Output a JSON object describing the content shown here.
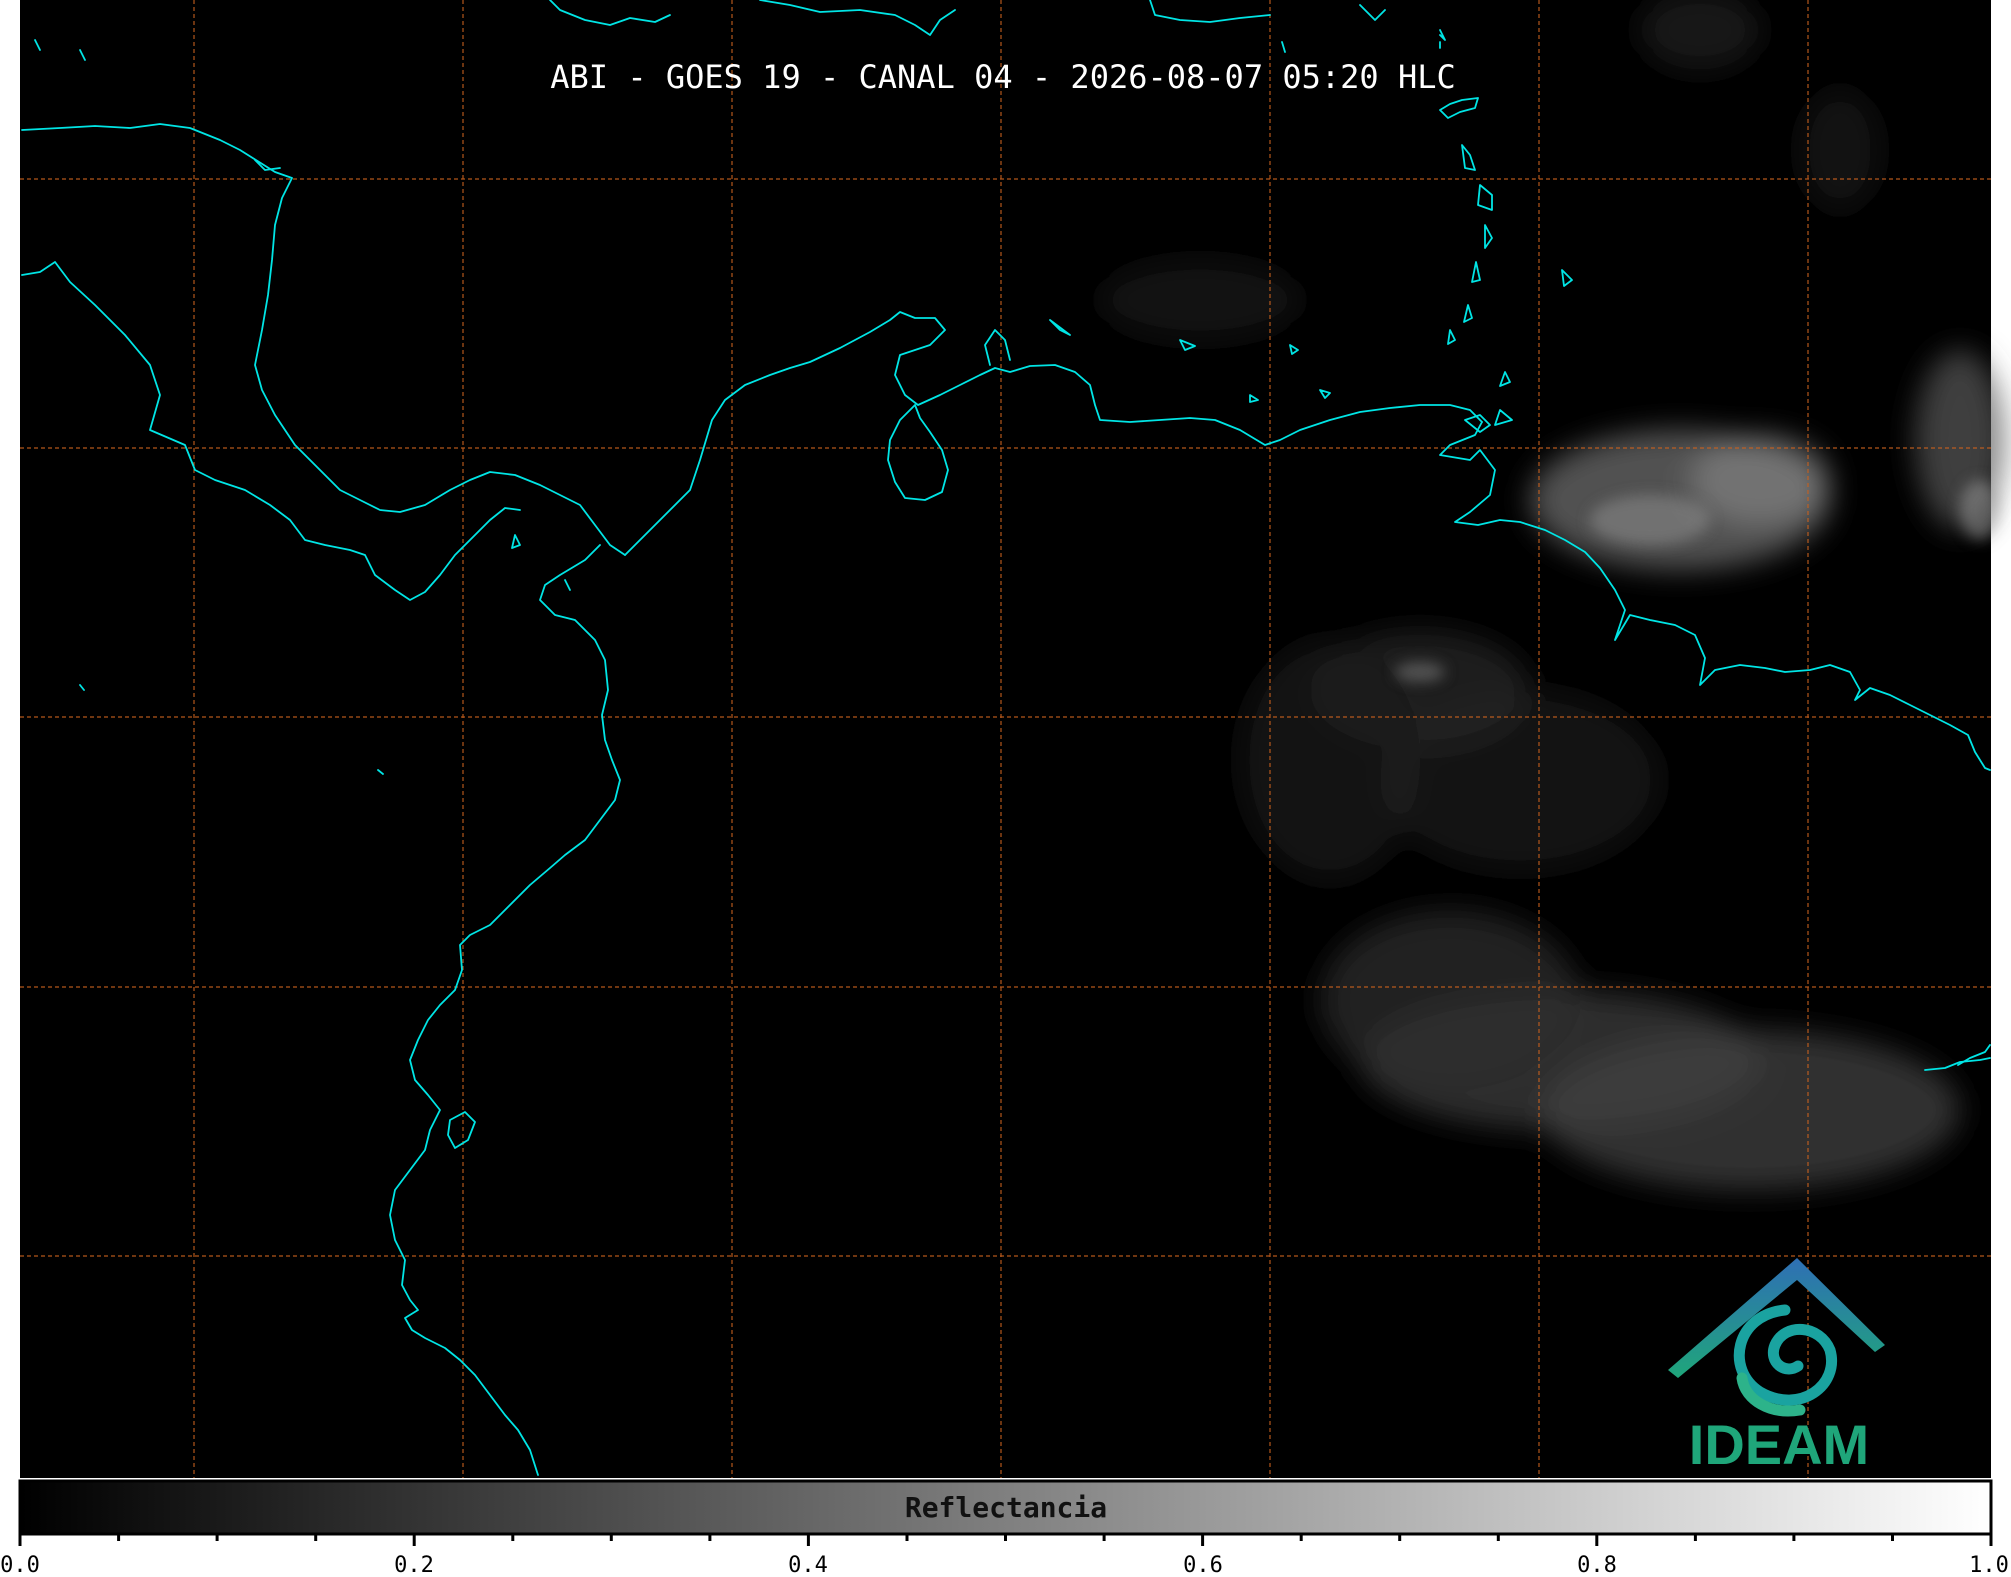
{
  "title": "ABI - GOES 19 - CANAL 04 - 2026-08-07 05:20 HLC",
  "colorbar": {
    "label": "Reflectancia",
    "tick_labels": [
      "0.0",
      "0.2",
      "0.4",
      "0.6",
      "0.8",
      "1.0"
    ],
    "range": [
      0.0,
      1.0
    ]
  },
  "logo": {
    "text": "IDEAM"
  },
  "colors": {
    "background": "#000000",
    "coastline": "#00e5e5",
    "gridlines": "#c8611e",
    "title": "#ffffff",
    "logo_text": "#1fa67a",
    "logo_blue": "#2f6fb5",
    "logo_teal": "#1aa3a0"
  }
}
